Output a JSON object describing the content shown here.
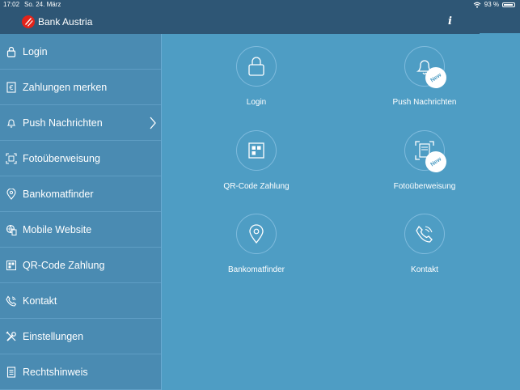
{
  "status": {
    "time": "17:02",
    "date": "So. 24. März",
    "battery": "93 %"
  },
  "header": {
    "brand": "Bank Austria",
    "info_label": "i"
  },
  "sidebar": {
    "items": [
      {
        "label": "Login",
        "icon": "lock-icon"
      },
      {
        "label": "Zahlungen merken",
        "icon": "euro-icon"
      },
      {
        "label": "Push Nachrichten",
        "icon": "bell-icon"
      },
      {
        "label": "Fotoüberweisung",
        "icon": "photo-transfer-icon"
      },
      {
        "label": "Bankomatfinder",
        "icon": "location-pin-icon"
      },
      {
        "label": "Mobile Website",
        "icon": "mobile-web-icon"
      },
      {
        "label": "QR-Code Zahlung",
        "icon": "qr-code-icon"
      },
      {
        "label": "Kontakt",
        "icon": "phone-icon"
      },
      {
        "label": "Einstellungen",
        "icon": "tools-icon"
      },
      {
        "label": "Rechtshinweis",
        "icon": "document-icon"
      }
    ]
  },
  "tiles": [
    {
      "label": "Login",
      "icon": "lock-icon"
    },
    {
      "label": "Push Nachrichten",
      "icon": "bell-icon",
      "badge": "New"
    },
    {
      "label": "QR-Code Zahlung",
      "icon": "qr-code-icon"
    },
    {
      "label": "Fotoüberweisung",
      "icon": "photo-transfer-icon",
      "badge": "New"
    },
    {
      "label": "Bankomatfinder",
      "icon": "location-pin-icon"
    },
    {
      "label": "Kontakt",
      "icon": "phone-icon"
    }
  ],
  "colors": {
    "header": "#2e5675",
    "sidebar": "#4a8bb2",
    "main": "#4e9dc4",
    "logo": "#e2231a"
  }
}
